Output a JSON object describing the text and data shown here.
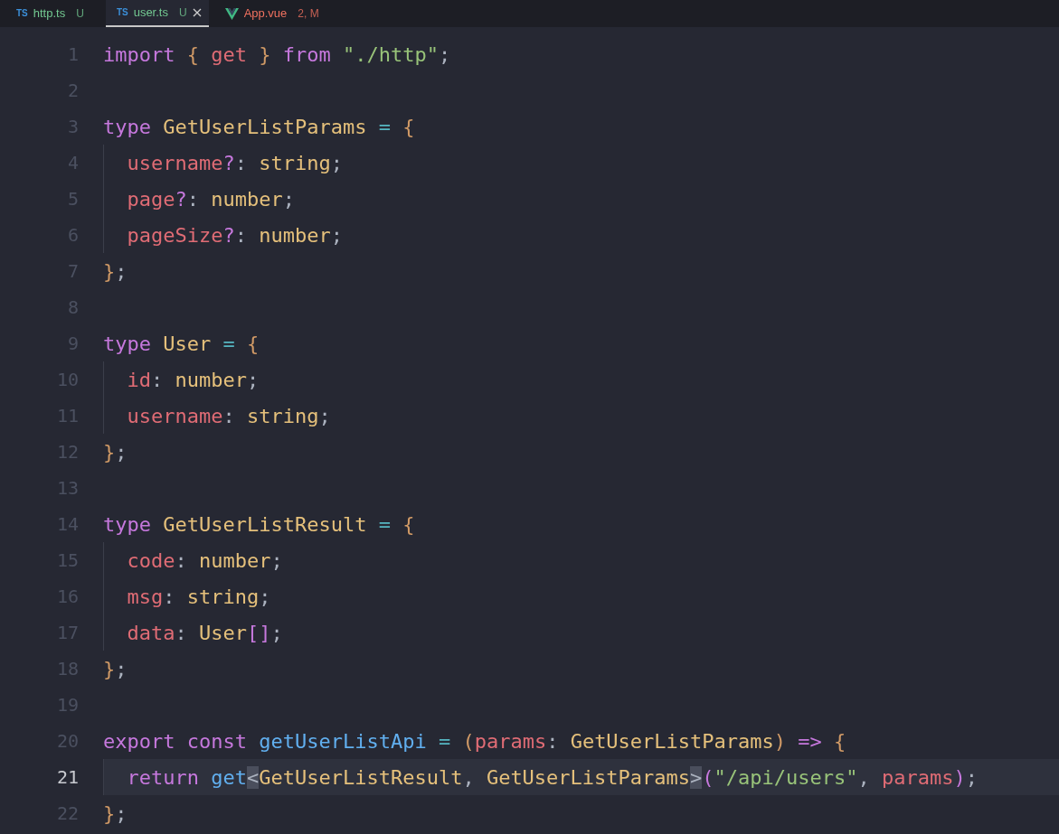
{
  "tabs": [
    {
      "label": "http.ts",
      "kind": "ts",
      "badge": "TS",
      "status": "U",
      "color": "#73c991",
      "selected": false
    },
    {
      "label": "user.ts",
      "kind": "ts",
      "badge": "TS",
      "status": "U",
      "color": "#73c991",
      "selected": true
    },
    {
      "label": "App.vue",
      "kind": "vue",
      "status": "2, M",
      "color": "#f0715f",
      "selected": false
    }
  ],
  "lines": [
    {
      "number": "1",
      "tokens": [
        {
          "text": "import",
          "kind": "keyword"
        },
        {
          "text": " {",
          "kind": "brace"
        },
        {
          "text": " get",
          "kind": "variable"
        },
        {
          "text": " }",
          "kind": "brace"
        },
        {
          "text": " from",
          "kind": "keyword"
        },
        {
          "text": " \"./http\"",
          "kind": "string"
        },
        {
          "text": ";",
          "kind": "plain"
        }
      ]
    },
    {
      "number": "2"
    },
    {
      "number": "3",
      "tokens": [
        {
          "text": "type",
          "kind": "keyword"
        },
        {
          "text": " GetUserListParams",
          "kind": "type"
        },
        {
          "text": " =",
          "kind": "operator"
        },
        {
          "text": " {",
          "kind": "brace"
        }
      ]
    },
    {
      "number": "4",
      "indent": true,
      "tokens": [
        {
          "text": "username",
          "kind": "variable"
        },
        {
          "text": "?",
          "kind": "keyword"
        },
        {
          "text": ":",
          "kind": "plain"
        },
        {
          "text": " string",
          "kind": "type"
        },
        {
          "text": ";",
          "kind": "plain"
        }
      ]
    },
    {
      "number": "5",
      "indent": true,
      "tokens": [
        {
          "text": "page",
          "kind": "variable"
        },
        {
          "text": "?",
          "kind": "keyword"
        },
        {
          "text": ":",
          "kind": "plain"
        },
        {
          "text": " number",
          "kind": "type"
        },
        {
          "text": ";",
          "kind": "plain"
        }
      ]
    },
    {
      "number": "6",
      "indent": true,
      "tokens": [
        {
          "text": "pageSize",
          "kind": "variable"
        },
        {
          "text": "?",
          "kind": "keyword"
        },
        {
          "text": ":",
          "kind": "plain"
        },
        {
          "text": " number",
          "kind": "type"
        },
        {
          "text": ";",
          "kind": "plain"
        }
      ]
    },
    {
      "number": "7",
      "tokens": [
        {
          "text": "}",
          "kind": "brace"
        },
        {
          "text": ";",
          "kind": "plain"
        }
      ]
    },
    {
      "number": "8"
    },
    {
      "number": "9",
      "tokens": [
        {
          "text": "type",
          "kind": "keyword"
        },
        {
          "text": " User",
          "kind": "type"
        },
        {
          "text": " =",
          "kind": "operator"
        },
        {
          "text": " {",
          "kind": "brace"
        }
      ]
    },
    {
      "number": "10",
      "indent": true,
      "tokens": [
        {
          "text": "id",
          "kind": "variable"
        },
        {
          "text": ":",
          "kind": "plain"
        },
        {
          "text": " number",
          "kind": "type"
        },
        {
          "text": ";",
          "kind": "plain"
        }
      ]
    },
    {
      "number": "11",
      "indent": true,
      "tokens": [
        {
          "text": "username",
          "kind": "variable"
        },
        {
          "text": ":",
          "kind": "plain"
        },
        {
          "text": " string",
          "kind": "type"
        },
        {
          "text": ";",
          "kind": "plain"
        }
      ]
    },
    {
      "number": "12",
      "tokens": [
        {
          "text": "}",
          "kind": "brace"
        },
        {
          "text": ";",
          "kind": "plain"
        }
      ]
    },
    {
      "number": "13"
    },
    {
      "number": "14",
      "tokens": [
        {
          "text": "type",
          "kind": "keyword"
        },
        {
          "text": " GetUserListResult",
          "kind": "type"
        },
        {
          "text": " =",
          "kind": "operator"
        },
        {
          "text": " {",
          "kind": "brace"
        }
      ]
    },
    {
      "number": "15",
      "indent": true,
      "tokens": [
        {
          "text": "code",
          "kind": "variable"
        },
        {
          "text": ":",
          "kind": "plain"
        },
        {
          "text": " number",
          "kind": "type"
        },
        {
          "text": ";",
          "kind": "plain"
        }
      ]
    },
    {
      "number": "16",
      "indent": true,
      "tokens": [
        {
          "text": "msg",
          "kind": "variable"
        },
        {
          "text": ":",
          "kind": "plain"
        },
        {
          "text": " string",
          "kind": "type"
        },
        {
          "text": ";",
          "kind": "plain"
        }
      ]
    },
    {
      "number": "17",
      "indent": true,
      "tokens": [
        {
          "text": "data",
          "kind": "variable"
        },
        {
          "text": ":",
          "kind": "plain"
        },
        {
          "text": " User",
          "kind": "type"
        },
        {
          "text": "[]",
          "kind": "keyword"
        },
        {
          "text": ";",
          "kind": "plain"
        }
      ]
    },
    {
      "number": "18",
      "tokens": [
        {
          "text": "}",
          "kind": "brace"
        },
        {
          "text": ";",
          "kind": "plain"
        }
      ]
    },
    {
      "number": "19"
    },
    {
      "number": "20",
      "tokens": [
        {
          "text": "export",
          "kind": "keyword"
        },
        {
          "text": " const",
          "kind": "keyword"
        },
        {
          "text": " getUserListApi",
          "kind": "function"
        },
        {
          "text": " =",
          "kind": "operator"
        },
        {
          "text": " (",
          "kind": "brace"
        },
        {
          "text": "params",
          "kind": "variable"
        },
        {
          "text": ":",
          "kind": "plain"
        },
        {
          "text": " GetUserListParams",
          "kind": "type"
        },
        {
          "text": ")",
          "kind": "brace"
        },
        {
          "text": " =>",
          "kind": "keyword"
        },
        {
          "text": " {",
          "kind": "brace"
        }
      ]
    },
    {
      "number": "21",
      "indent": true,
      "current": true,
      "tokens": [
        {
          "text": "return",
          "kind": "keyword"
        },
        {
          "text": " get",
          "kind": "function"
        },
        {
          "text": "<",
          "kind": "bracket-match"
        },
        {
          "text": "GetUserListResult",
          "kind": "type"
        },
        {
          "text": ",",
          "kind": "plain"
        },
        {
          "text": " GetUserListParams",
          "kind": "type"
        },
        {
          "text": ">",
          "kind": "bracket-match"
        },
        {
          "text": "(",
          "kind": "keyword"
        },
        {
          "text": "\"/api/users\"",
          "kind": "string"
        },
        {
          "text": ",",
          "kind": "plain"
        },
        {
          "text": " params",
          "kind": "variable"
        },
        {
          "text": ")",
          "kind": "keyword"
        },
        {
          "text": ";",
          "kind": "plain"
        }
      ]
    },
    {
      "number": "22",
      "tokens": [
        {
          "text": "}",
          "kind": "brace"
        },
        {
          "text": ";",
          "kind": "plain"
        }
      ]
    }
  ]
}
